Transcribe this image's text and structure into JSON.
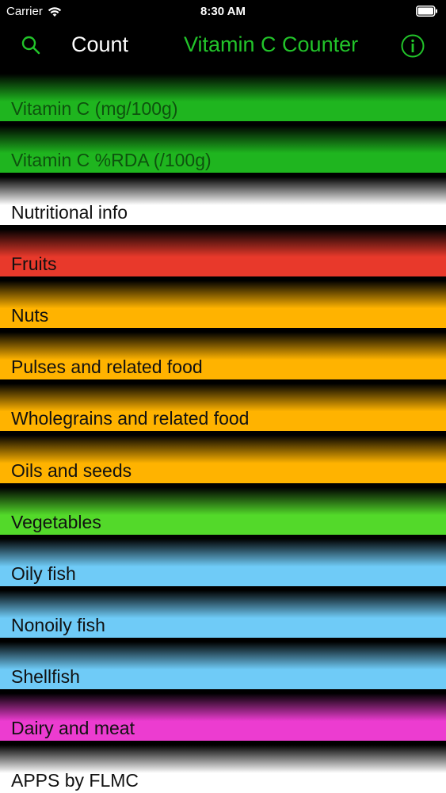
{
  "status_bar": {
    "carrier": "Carrier",
    "time": "8:30 AM"
  },
  "nav": {
    "count_label": "Count",
    "title": "Vitamin C Counter",
    "title_color": "#22c42a",
    "icons": [
      "search-icon",
      "info-icon"
    ]
  },
  "rows": [
    {
      "label": "Vitamin C (mg/100g)",
      "color": "#1fb51f"
    },
    {
      "label": "Vitamin C %RDA (/100g)",
      "color": "#1fb51f"
    },
    {
      "label": "Nutritional info",
      "color": "#ffffff"
    },
    {
      "label": "Fruits",
      "color": "#e8392b"
    },
    {
      "label": "Nuts",
      "color": "#ffb300"
    },
    {
      "label": "Pulses and related food",
      "color": "#ffb300"
    },
    {
      "label": "Wholegrains and related food",
      "color": "#ffb300"
    },
    {
      "label": "Oils and seeds",
      "color": "#ffb300"
    },
    {
      "label": "Vegetables",
      "color": "#53d92a"
    },
    {
      "label": "Oily fish",
      "color": "#6fcbf7"
    },
    {
      "label": "Nonoily fish",
      "color": "#6fcbf7"
    },
    {
      "label": "Shellfish",
      "color": "#6fcbf7"
    },
    {
      "label": "Dairy and meat",
      "color": "#ec3cd0"
    },
    {
      "label": "APPS by FLMC",
      "color": "#ffffff"
    }
  ]
}
